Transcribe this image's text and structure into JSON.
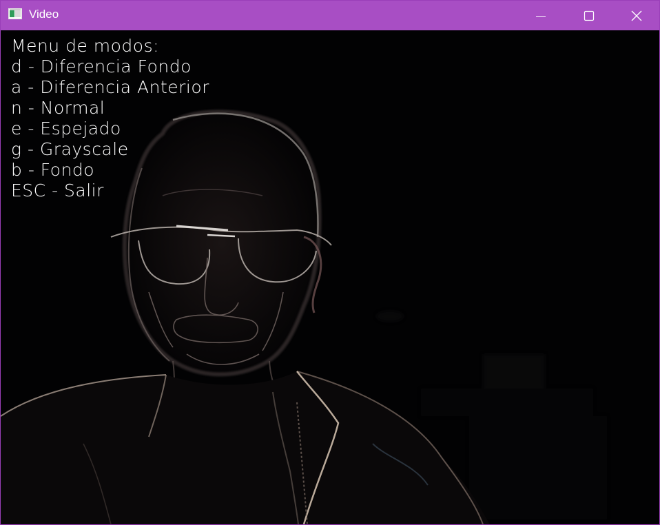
{
  "window": {
    "title": "Video",
    "titlebar_color": "#a84ec4",
    "controls": {
      "minimize_icon": "minimize-icon",
      "maximize_icon": "maximize-icon",
      "close_icon": "close-icon"
    }
  },
  "overlay": {
    "heading": "Menu de modos:",
    "items": [
      "d - Diferencia Fondo",
      "a - Diferencia Anterior",
      "n - Normal",
      "e - Espejado",
      "g - Grayscale",
      "b - Fondo",
      "ESC - Salir"
    ],
    "text_color": "#ffffff"
  },
  "video": {
    "background_color": "#020203",
    "content": "edge-filtered webcam frame"
  }
}
